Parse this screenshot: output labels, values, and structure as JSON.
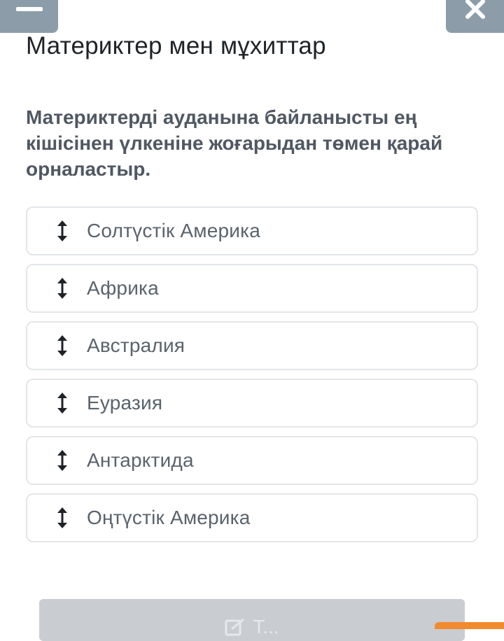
{
  "header": {
    "menu_icon": "hamburger-menu-icon",
    "close_icon": "close-icon",
    "title": "Материктер мен мұхиттар"
  },
  "question": {
    "text": "Материктерді ауданына байланысты ең кішісінен үлкеніне жоғарыдан төмен қарай орналастыр."
  },
  "options": [
    {
      "label": "Солтүстік Америка",
      "icon": "drag-handle-icon"
    },
    {
      "label": "Африка",
      "icon": "drag-handle-icon"
    },
    {
      "label": "Австралия",
      "icon": "drag-handle-icon"
    },
    {
      "label": "Еуразия",
      "icon": "drag-handle-icon"
    },
    {
      "label": "Антарктида",
      "icon": "drag-handle-icon"
    },
    {
      "label": "Оңтүстік Америка",
      "icon": "drag-handle-icon"
    }
  ],
  "submit": {
    "icon": "edit-check-icon",
    "label": "Т..."
  },
  "colors": {
    "top_buttons": "#8c9da9",
    "accent": "#f28a2e",
    "option_border": "#e3e6e9"
  }
}
